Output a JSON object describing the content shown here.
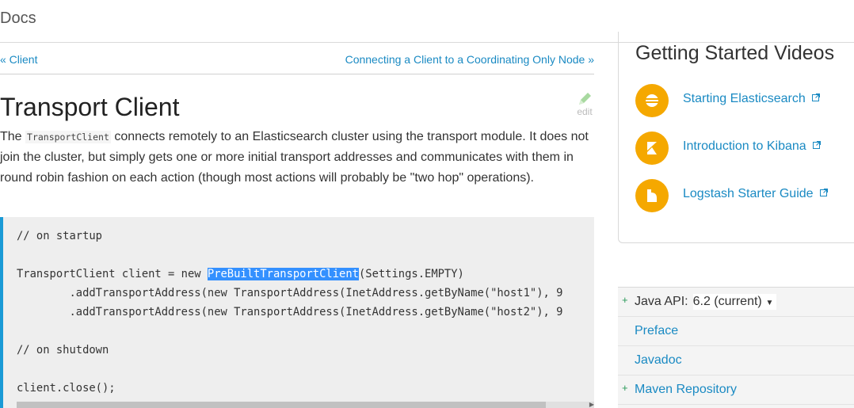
{
  "header": {
    "docs_label": "Docs"
  },
  "nav": {
    "prev_label": "« Client",
    "next_label": "Connecting a Client to a Coordinating Only Node »"
  },
  "article": {
    "title": "Transport Client",
    "edit_label": "edit",
    "intro_before": "The ",
    "intro_code": "TransportClient",
    "intro_after": " connects remotely to an Elasticsearch cluster using the transport module. It does not join the cluster, but simply gets one or more initial transport addresses and communicates with them in round robin fashion on each action (though most actions will probably be \"two hop\" operations).",
    "code": {
      "line1": "// on startup",
      "line2_before": "TransportClient client = new ",
      "line2_highlight": "PreBuiltTransportClient",
      "line2_after": "(Settings.EMPTY)",
      "line3": "        .addTransportAddress(new TransportAddress(InetAddress.getByName(\"host1\"), 9",
      "line4": "        .addTransportAddress(new TransportAddress(InetAddress.getByName(\"host2\"), 9",
      "line5": "// on shutdown",
      "line6": "client.close();"
    }
  },
  "sidebar": {
    "videos_title": "Getting Started Videos",
    "videos": [
      {
        "label": "Starting Elasticsearch",
        "icon": "elasticsearch-logo-icon"
      },
      {
        "label": "Introduction to Kibana",
        "icon": "kibana-logo-icon"
      },
      {
        "label": "Logstash Starter Guide",
        "icon": "logstash-logo-icon"
      }
    ],
    "toc": {
      "java_api_label": "Java API:",
      "version": "6.2 (current)",
      "items": [
        "Preface",
        "Javadoc",
        "Maven Repository"
      ]
    }
  },
  "colors": {
    "link": "#1a8ac3",
    "accent": "#f5a800",
    "code_border": "#1a9ad6",
    "selection": "#3390ff"
  }
}
